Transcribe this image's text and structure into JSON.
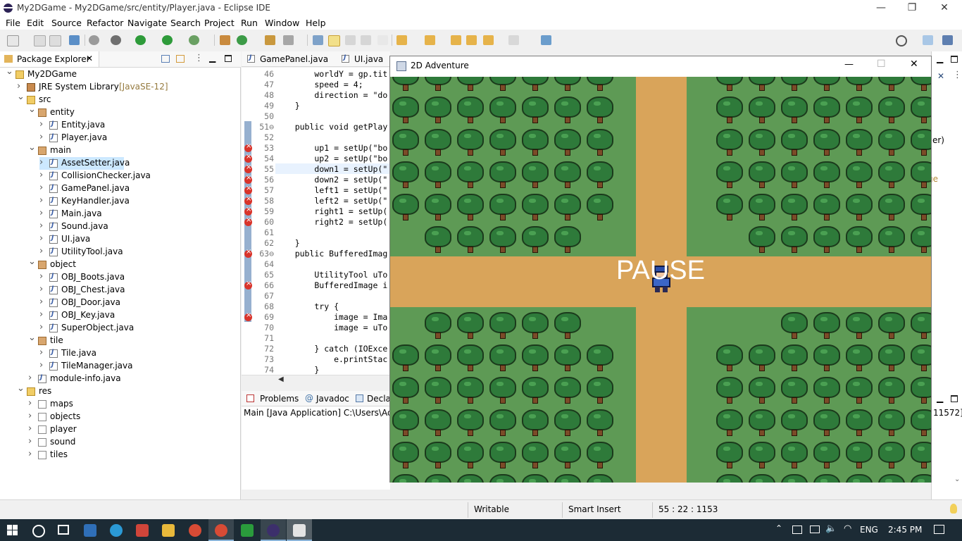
{
  "window": {
    "title": "My2DGame - My2DGame/src/entity/Player.java - Eclipse IDE",
    "minimize": "—",
    "restore": "❐",
    "close": "✕"
  },
  "menu": [
    "File",
    "Edit",
    "Source",
    "Refactor",
    "Navigate",
    "Search",
    "Project",
    "Run",
    "Window",
    "Help"
  ],
  "package_explorer": {
    "tab_label": "Package Explorer",
    "tree": [
      {
        "label": "My2DGame",
        "level": 0,
        "icon": "project-icon",
        "expanded": true
      },
      {
        "label": "JRE System Library",
        "suffix": "[JavaSE-12]",
        "level": 1,
        "icon": "library-icon",
        "expanded": false
      },
      {
        "label": "src",
        "level": 1,
        "icon": "folder-icon",
        "expanded": true
      },
      {
        "label": "entity",
        "level": 2,
        "icon": "package-icon",
        "expanded": true
      },
      {
        "label": "Entity.java",
        "level": 3,
        "icon": "java-file-icon",
        "expanded": false
      },
      {
        "label": "Player.java",
        "level": 3,
        "icon": "java-file-icon",
        "expanded": false
      },
      {
        "label": "main",
        "level": 2,
        "icon": "package-icon",
        "expanded": true
      },
      {
        "label": "AssetSetter.java",
        "level": 3,
        "icon": "java-file-icon",
        "expanded": false,
        "selected": true
      },
      {
        "label": "CollisionChecker.java",
        "level": 3,
        "icon": "java-file-icon",
        "expanded": false
      },
      {
        "label": "GamePanel.java",
        "level": 3,
        "icon": "java-file-icon",
        "expanded": false
      },
      {
        "label": "KeyHandler.java",
        "level": 3,
        "icon": "java-file-icon",
        "expanded": false
      },
      {
        "label": "Main.java",
        "level": 3,
        "icon": "java-file-icon",
        "expanded": false
      },
      {
        "label": "Sound.java",
        "level": 3,
        "icon": "java-file-icon",
        "expanded": false
      },
      {
        "label": "UI.java",
        "level": 3,
        "icon": "java-file-icon",
        "expanded": false
      },
      {
        "label": "UtilityTool.java",
        "level": 3,
        "icon": "java-file-icon",
        "expanded": false
      },
      {
        "label": "object",
        "level": 2,
        "icon": "package-icon",
        "expanded": true
      },
      {
        "label": "OBJ_Boots.java",
        "level": 3,
        "icon": "java-file-icon",
        "expanded": false
      },
      {
        "label": "OBJ_Chest.java",
        "level": 3,
        "icon": "java-file-icon",
        "expanded": false
      },
      {
        "label": "OBJ_Door.java",
        "level": 3,
        "icon": "java-file-icon",
        "expanded": false
      },
      {
        "label": "OBJ_Key.java",
        "level": 3,
        "icon": "java-file-icon",
        "expanded": false
      },
      {
        "label": "SuperObject.java",
        "level": 3,
        "icon": "java-file-icon",
        "expanded": false
      },
      {
        "label": "tile",
        "level": 2,
        "icon": "package-icon",
        "expanded": true
      },
      {
        "label": "Tile.java",
        "level": 3,
        "icon": "java-file-icon",
        "expanded": false
      },
      {
        "label": "TileManager.java",
        "level": 3,
        "icon": "java-file-icon",
        "expanded": false
      },
      {
        "label": "module-info.java",
        "level": 2,
        "icon": "java-file-icon",
        "expanded": false
      },
      {
        "label": "res",
        "level": 1,
        "icon": "folder-icon",
        "expanded": true
      },
      {
        "label": "maps",
        "level": 2,
        "icon": "resource-folder-icon",
        "expanded": false
      },
      {
        "label": "objects",
        "level": 2,
        "icon": "resource-folder-icon",
        "expanded": false
      },
      {
        "label": "player",
        "level": 2,
        "icon": "resource-folder-icon",
        "expanded": false
      },
      {
        "label": "sound",
        "level": 2,
        "icon": "resource-folder-icon",
        "expanded": false
      },
      {
        "label": "tiles",
        "level": 2,
        "icon": "resource-folder-icon",
        "expanded": false
      }
    ]
  },
  "editor": {
    "tabs": [
      "GamePanel.java",
      "UI.java"
    ],
    "lines": [
      {
        "n": "46",
        "code": "        worldY = gp.tit",
        "err": false
      },
      {
        "n": "47",
        "code": "        speed = 4;",
        "err": false
      },
      {
        "n": "48",
        "code": "        direction = \"do",
        "err": false
      },
      {
        "n": "49",
        "code": "    }",
        "err": false
      },
      {
        "n": "50",
        "code": "",
        "err": false
      },
      {
        "n": "51⊖",
        "code": "    public void getPlay",
        "err": false
      },
      {
        "n": "52",
        "code": "",
        "err": false
      },
      {
        "n": "53",
        "code": "        up1 = setUp(\"bo",
        "err": true
      },
      {
        "n": "54",
        "code": "        up2 = setUp(\"bo",
        "err": true
      },
      {
        "n": "55",
        "code": "        down1 = setUp(\"",
        "err": true
      },
      {
        "n": "56",
        "code": "        down2 = setUp(\"",
        "err": true
      },
      {
        "n": "57",
        "code": "        left1 = setUp(\"",
        "err": true
      },
      {
        "n": "58",
        "code": "        left2 = setUp(\"",
        "err": true
      },
      {
        "n": "59",
        "code": "        right1 = setUp(",
        "err": true
      },
      {
        "n": "60",
        "code": "        right2 = setUp(",
        "err": true
      },
      {
        "n": "61",
        "code": "",
        "err": false
      },
      {
        "n": "62",
        "code": "    }",
        "err": false
      },
      {
        "n": "63⊖",
        "code": "    public BufferedImag",
        "err": true
      },
      {
        "n": "64",
        "code": "",
        "err": false
      },
      {
        "n": "65",
        "code": "        UtilityTool uTo",
        "err": false
      },
      {
        "n": "66",
        "code": "        BufferedImage i",
        "err": true
      },
      {
        "n": "67",
        "code": "",
        "err": false
      },
      {
        "n": "68",
        "code": "        try {",
        "err": false
      },
      {
        "n": "69",
        "code": "            image = Ima",
        "err": true
      },
      {
        "n": "70",
        "code": "            image = uTo",
        "err": false
      },
      {
        "n": "71",
        "code": "",
        "err": false
      },
      {
        "n": "72",
        "code": "        } catch (IOExce",
        "err": false
      },
      {
        "n": "73",
        "code": "            e.printStac",
        "err": false
      },
      {
        "n": "74",
        "code": "        }",
        "err": false
      }
    ]
  },
  "console": {
    "tabs": [
      "Problems",
      "Javadoc",
      "Declar"
    ],
    "launch_text": "Main [Java Application] C:\\Users\\Admin",
    "right_fragment": "11572]"
  },
  "right_fragments": {
    "handler": "dler)",
    "age": "ge"
  },
  "statusbar": {
    "writable": "Writable",
    "insert_mode": "Smart Insert",
    "position": "55 : 22 : 1153"
  },
  "game": {
    "title": "2D Adventure",
    "overlay": "PAUSE",
    "minimize": "—",
    "maximize": "☐",
    "close": "✕"
  },
  "taskbar": {
    "language": "ENG",
    "time": "2:45 PM"
  }
}
